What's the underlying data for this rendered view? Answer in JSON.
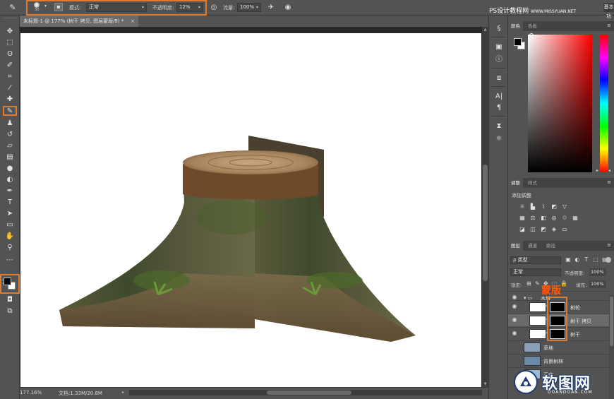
{
  "options_bar": {
    "brush_size": "30",
    "mode_label": "模式:",
    "mode_value": "正常",
    "opacity_label": "不透明度:",
    "opacity_value": "12%",
    "flow_label": "流量:",
    "flow_value": "100%",
    "workspace_button": "基本功"
  },
  "watermark_top": {
    "main": "PS设计教程网",
    "sub": "WWW.MISSYUAN.NET"
  },
  "document": {
    "tab_title": "未标题-1 @ 177% (树干 拷贝, 图层蒙版/8) *",
    "close_glyph": "×",
    "status_zoom": "177.16%",
    "status_doc": "文档:1.33M/20.8M"
  },
  "color_panel": {
    "tabs": [
      "颜色",
      "色板"
    ]
  },
  "adjustments_panel": {
    "tabs": [
      "调整",
      "样式"
    ],
    "add_label": "添加调整"
  },
  "layers_panel": {
    "tabs": [
      "图层",
      "通道",
      "路径"
    ],
    "filter_value": "ρ 类型",
    "blend_mode": "正常",
    "opacity_label": "不透明度:",
    "opacity_value": "100%",
    "lock_label": "锁定:",
    "fill_label": "填充:",
    "fill_value": "100%",
    "mask_annotation": "蒙版",
    "group_name": "木墩",
    "layers": [
      {
        "name": "树轮"
      },
      {
        "name": "树干 拷贝"
      },
      {
        "name": "树干"
      },
      {
        "name": "草地"
      },
      {
        "name": "背景树林"
      },
      {
        "name": "天空"
      }
    ]
  },
  "watermark_br": {
    "main": "软图网",
    "sub": "DOANDOAN.COM"
  },
  "icons": {
    "tool_icon_color": "#e2e2e2",
    "highlight_color": "#e07a2e",
    "annotation_color": "#ff5a00"
  }
}
